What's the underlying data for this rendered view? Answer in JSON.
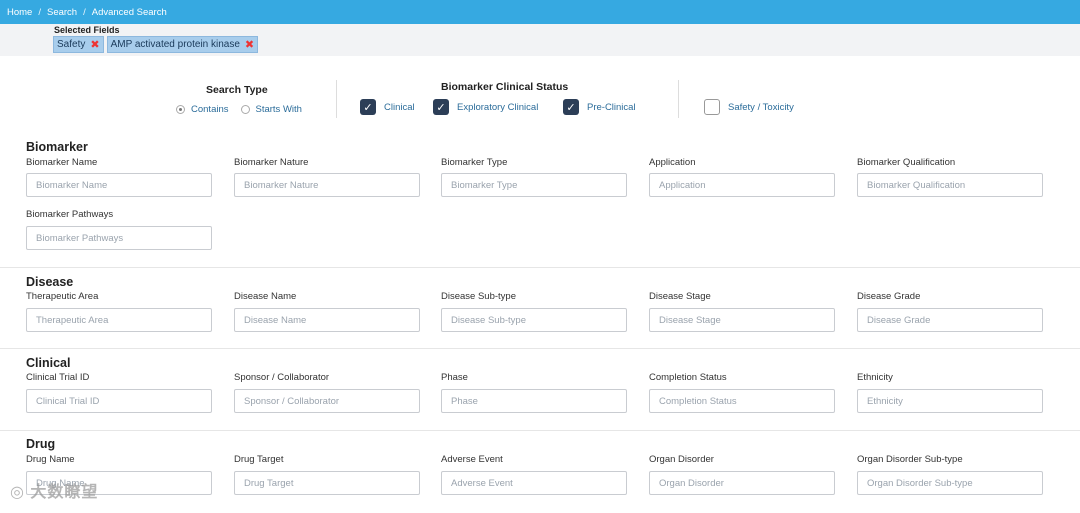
{
  "breadcrumb": {
    "home": "Home",
    "search": "Search",
    "current": "Advanced Search",
    "separator": "/"
  },
  "selected": {
    "label": "Selected Fields",
    "chips": [
      "Safety",
      "AMP activated protein kinase"
    ],
    "remove_glyph": "✖"
  },
  "search_type": {
    "title": "Search Type",
    "options": [
      "Contains",
      "Starts With"
    ],
    "selected": "Contains"
  },
  "biomarker_status": {
    "title": "Biomarker Clinical Status",
    "options": [
      {
        "label": "Clinical",
        "checked": true
      },
      {
        "label": "Exploratory Clinical",
        "checked": true
      },
      {
        "label": "Pre-Clinical",
        "checked": true
      }
    ]
  },
  "safety_toxicity": {
    "label": "Safety / Toxicity",
    "checked": false
  },
  "sections": {
    "biomarker": {
      "title": "Biomarker",
      "fields": [
        {
          "label": "Biomarker Name",
          "placeholder": "Biomarker Name"
        },
        {
          "label": "Biomarker Nature",
          "placeholder": "Biomarker Nature"
        },
        {
          "label": "Biomarker Type",
          "placeholder": "Biomarker Type"
        },
        {
          "label": "Application",
          "placeholder": "Application"
        },
        {
          "label": "Biomarker Qualification",
          "placeholder": "Biomarker Qualification"
        },
        {
          "label": "Biomarker Pathways",
          "placeholder": "Biomarker Pathways"
        }
      ]
    },
    "disease": {
      "title": "Disease",
      "fields": [
        {
          "label": "Therapeutic Area",
          "placeholder": "Therapeutic Area"
        },
        {
          "label": "Disease Name",
          "placeholder": "Disease Name"
        },
        {
          "label": "Disease Sub-type",
          "placeholder": "Disease Sub-type"
        },
        {
          "label": "Disease Stage",
          "placeholder": "Disease Stage"
        },
        {
          "label": "Disease Grade",
          "placeholder": "Disease Grade"
        }
      ]
    },
    "clinical": {
      "title": "Clinical",
      "fields": [
        {
          "label": "Clinical Trial ID",
          "placeholder": "Clinical Trial ID"
        },
        {
          "label": "Sponsor / Collaborator",
          "placeholder": "Sponsor / Collaborator"
        },
        {
          "label": "Phase",
          "placeholder": "Phase"
        },
        {
          "label": "Completion Status",
          "placeholder": "Completion Status"
        },
        {
          "label": "Ethnicity",
          "placeholder": "Ethnicity"
        }
      ]
    },
    "drug": {
      "title": "Drug",
      "fields": [
        {
          "label": "Drug Name",
          "placeholder": "Drug Name"
        },
        {
          "label": "Drug Target",
          "placeholder": "Drug Target"
        },
        {
          "label": "Adverse Event",
          "placeholder": "Adverse Event"
        },
        {
          "label": "Organ Disorder",
          "placeholder": "Organ Disorder"
        },
        {
          "label": "Organ Disorder Sub-type",
          "placeholder": "Organ Disorder Sub-type"
        }
      ]
    }
  },
  "watermark": "大数瞭望"
}
